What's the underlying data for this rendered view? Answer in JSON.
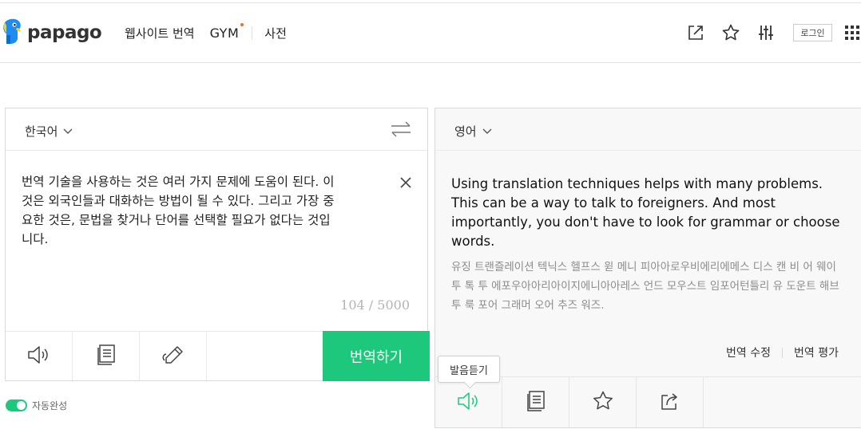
{
  "header": {
    "logo_text": "papago",
    "nav": [
      {
        "label": "웹사이트 번역"
      },
      {
        "label": "GYM"
      },
      {
        "label": "사전"
      }
    ],
    "login_label": "로그인",
    "icons": [
      "external-link-icon",
      "star-icon",
      "settings-sliders-icon",
      "apps-grid-icon"
    ]
  },
  "source": {
    "language": "한국어",
    "text": "번역 기술을 사용하는 것은 여러 가지 문제에 도움이 된다. 이\n것은 외국인들과 대화하는 방법이 될 수 있다. 그리고 가장 중\n요한 것은, 문법을 찾거나 단어를 선택할 필요가 없다는 것입\n니다.",
    "counter": "104 / 5000",
    "translate_button": "번역하기",
    "tools": [
      "speaker-icon",
      "notebook-icon",
      "pen-icon"
    ]
  },
  "target": {
    "language": "영어",
    "text": "Using translation techniques helps with many problems. This can be a way to talk to foreigners. And most importantly, you don't have to look for grammar or choose words.",
    "pronunciation": "유징 트랜즐레이션 텍닉스 헬프스 윋 메니 피아아로우비에리에메스 디스 캔 비 어 웨이 투 톡 투 에포우아아리아이지에니아아레스 언드 모우스트 임포어턴틀리 유 도운트 해브 투 룩 포어 그래머 오어 추즈 워즈.",
    "edit_link": "번역 수정",
    "rate_link": "번역 평가",
    "tooltip": "발음듣기",
    "tools": [
      "speaker-icon",
      "notebook-icon",
      "star-icon",
      "share-icon"
    ]
  },
  "autocomplete": {
    "label": "자동완성",
    "enabled": true
  },
  "colors": {
    "accent": "#1dc87c",
    "logo_blue": "#1e8cf0",
    "logo_yellow": "#ffd200",
    "gym_dot": "#f36b2b"
  }
}
